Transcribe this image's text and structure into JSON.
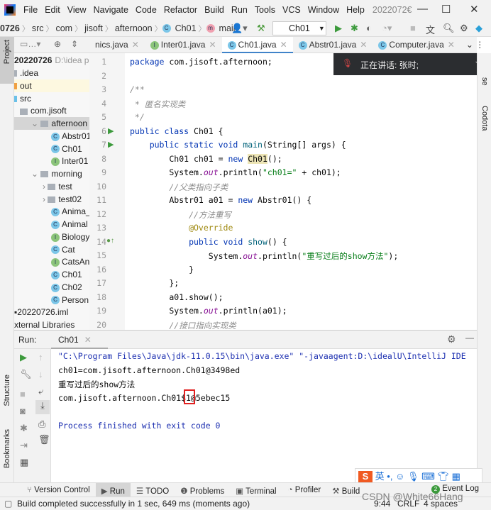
{
  "titlebar": {
    "menus": [
      "File",
      "Edit",
      "View",
      "Navigate",
      "Code",
      "Refactor",
      "Build",
      "Run",
      "Tools",
      "VCS",
      "Window",
      "Help"
    ],
    "title": "2022072€",
    "minimize": "—",
    "maximize": "☐",
    "close": "✕"
  },
  "navbar": {
    "crumbs": [
      "0726",
      "src",
      "com",
      "jisoft",
      "afternoon",
      "Ch01",
      "main"
    ],
    "run_config": "Ch01"
  },
  "project": {
    "tab_label": "Project",
    "root": "20220726",
    "root_path": "D:\\idea pro",
    "items": [
      {
        "label": ".idea",
        "indent": 0,
        "icon": "folder"
      },
      {
        "label": "out",
        "indent": 0,
        "icon": "folder-orange"
      },
      {
        "label": "src",
        "indent": 0,
        "icon": "folder-blue"
      },
      {
        "label": "com.jisoft",
        "indent": 1,
        "icon": "package"
      },
      {
        "label": "afternoon",
        "indent": 2,
        "icon": "package",
        "expanded": true,
        "selected": true
      },
      {
        "label": "Abstr01",
        "indent": 3,
        "icon": "abstract-class"
      },
      {
        "label": "Ch01",
        "indent": 3,
        "icon": "class-runnable"
      },
      {
        "label": "Inter01",
        "indent": 3,
        "icon": "interface"
      },
      {
        "label": "morning",
        "indent": 2,
        "icon": "package",
        "expanded": true
      },
      {
        "label": "test",
        "indent": 3,
        "icon": "package",
        "collapsed": true
      },
      {
        "label": "test02",
        "indent": 3,
        "icon": "package",
        "collapsed": true
      },
      {
        "label": "Anima_So",
        "indent": 3,
        "icon": "abstract-class"
      },
      {
        "label": "Animal",
        "indent": 3,
        "icon": "abstract-class"
      },
      {
        "label": "Biology",
        "indent": 3,
        "icon": "interface"
      },
      {
        "label": "Cat",
        "indent": 3,
        "icon": "class"
      },
      {
        "label": "CatsAnima",
        "indent": 3,
        "icon": "interface"
      },
      {
        "label": "Ch01",
        "indent": 3,
        "icon": "class-runnable"
      },
      {
        "label": "Ch02",
        "indent": 3,
        "icon": "class-runnable"
      },
      {
        "label": "Person",
        "indent": 3,
        "icon": "class"
      },
      {
        "label": "20220726.iml",
        "indent": 0,
        "icon": "file"
      },
      {
        "label": "xternal Libraries",
        "indent": -1,
        "icon": "none"
      }
    ]
  },
  "tabs": [
    {
      "label": "nics.java",
      "icon": "none"
    },
    {
      "label": "Inter01.java",
      "icon": "I"
    },
    {
      "label": "Ch01.java",
      "icon": "C",
      "active": true
    },
    {
      "label": "Abstr01.java",
      "icon": "C"
    },
    {
      "label": "Computer.java",
      "icon": "C"
    }
  ],
  "editor": {
    "lines": [
      [
        [
          "package",
          "kw"
        ],
        [
          " com.jisoft.afternoon;",
          ""
        ]
      ],
      [],
      [
        [
          "/**",
          "cm"
        ]
      ],
      [
        [
          " * 匿名实现类",
          "cm"
        ]
      ],
      [
        [
          " */",
          "cm"
        ]
      ],
      [
        [
          "public class",
          "kw"
        ],
        [
          " Ch01 {",
          ""
        ]
      ],
      [
        [
          "    public static void",
          "kw"
        ],
        [
          " ",
          ""
        ],
        [
          "main",
          "fn"
        ],
        [
          "(String[] args) {",
          ""
        ]
      ],
      [
        [
          "        Ch01 ch01 = ",
          ""
        ],
        [
          "new",
          "kw"
        ],
        [
          " ",
          ""
        ],
        [
          "Ch01",
          "hl"
        ],
        [
          "();",
          ""
        ]
      ],
      [
        [
          "        System.",
          ""
        ],
        [
          "out",
          "fld"
        ],
        [
          ".println(",
          ""
        ],
        [
          "\"ch01=\"",
          "str"
        ],
        [
          " + ch01);",
          ""
        ]
      ],
      [
        [
          "        //父类指向子类",
          "cm"
        ]
      ],
      [
        [
          "        Abstr01 a01 = ",
          ""
        ],
        [
          "new",
          "kw"
        ],
        [
          " Abstr01() {",
          ""
        ]
      ],
      [
        [
          "            //方法重写",
          "cm"
        ]
      ],
      [
        [
          "            @Override",
          "ann"
        ]
      ],
      [
        [
          "            public void",
          "kw"
        ],
        [
          " ",
          ""
        ],
        [
          "show",
          "fn"
        ],
        [
          "() {",
          ""
        ]
      ],
      [
        [
          "                System.",
          ""
        ],
        [
          "out",
          "fld"
        ],
        [
          ".println(",
          ""
        ],
        [
          "\"重写过后的show方法\"",
          "str"
        ],
        [
          ");",
          ""
        ]
      ],
      [
        [
          "            }",
          ""
        ]
      ],
      [
        [
          "        };",
          ""
        ]
      ],
      [
        [
          "        a01.show();",
          ""
        ]
      ],
      [
        [
          "        System.",
          ""
        ],
        [
          "out",
          "fld"
        ],
        [
          ".println(a01);",
          ""
        ]
      ],
      [
        [
          "        //接口指向实现类",
          "cm"
        ]
      ]
    ]
  },
  "meeting_overlay": {
    "text": "正在讲话: 张时;"
  },
  "right_stripe": {
    "items": [
      "se",
      "Codota"
    ]
  },
  "run": {
    "label": "Run:",
    "tab": "Ch01",
    "console": [
      {
        "text": "\"C:\\Program Files\\Java\\jdk-11.0.15\\bin\\java.exe\" \"-javaagent:D:\\idealU\\IntelliJ IDE",
        "color": "#1c2fb0"
      },
      {
        "text": "ch01=com.jisoft.afternoon.Ch01@3498ed",
        "color": "#080808"
      },
      {
        "text": "重写过后的show方法",
        "color": "#080808"
      },
      {
        "text": "com.jisoft.afternoon.Ch01$1@5ebec15",
        "color": "#080808"
      },
      {
        "text": "",
        "color": "#080808"
      },
      {
        "text": "Process finished with exit code 0",
        "color": "#1c2fb0"
      }
    ]
  },
  "left_stripe": {
    "structure": "Structure",
    "bookmarks": "Bookmarks"
  },
  "tool_windows": [
    {
      "label": "Version Control",
      "icon": "⑂"
    },
    {
      "label": "Run",
      "icon": "▶",
      "active": true
    },
    {
      "label": "TODO",
      "icon": "☰"
    },
    {
      "label": "Problems",
      "icon": "❶"
    },
    {
      "label": "Terminal",
      "icon": "▣"
    },
    {
      "label": "Profiler",
      "icon": "◔"
    },
    {
      "label": "Build",
      "icon": "⚒"
    }
  ],
  "event_log": {
    "label": "Event Log",
    "count": "2"
  },
  "status": {
    "message": "Build completed successfully in 1 sec, 649 ms (moments ago)",
    "position": "9:44",
    "line_sep": "CRLF",
    "indent": "4 spaces"
  },
  "ime": {
    "mode": "英"
  },
  "watermark": "CSDN @White66Hang"
}
